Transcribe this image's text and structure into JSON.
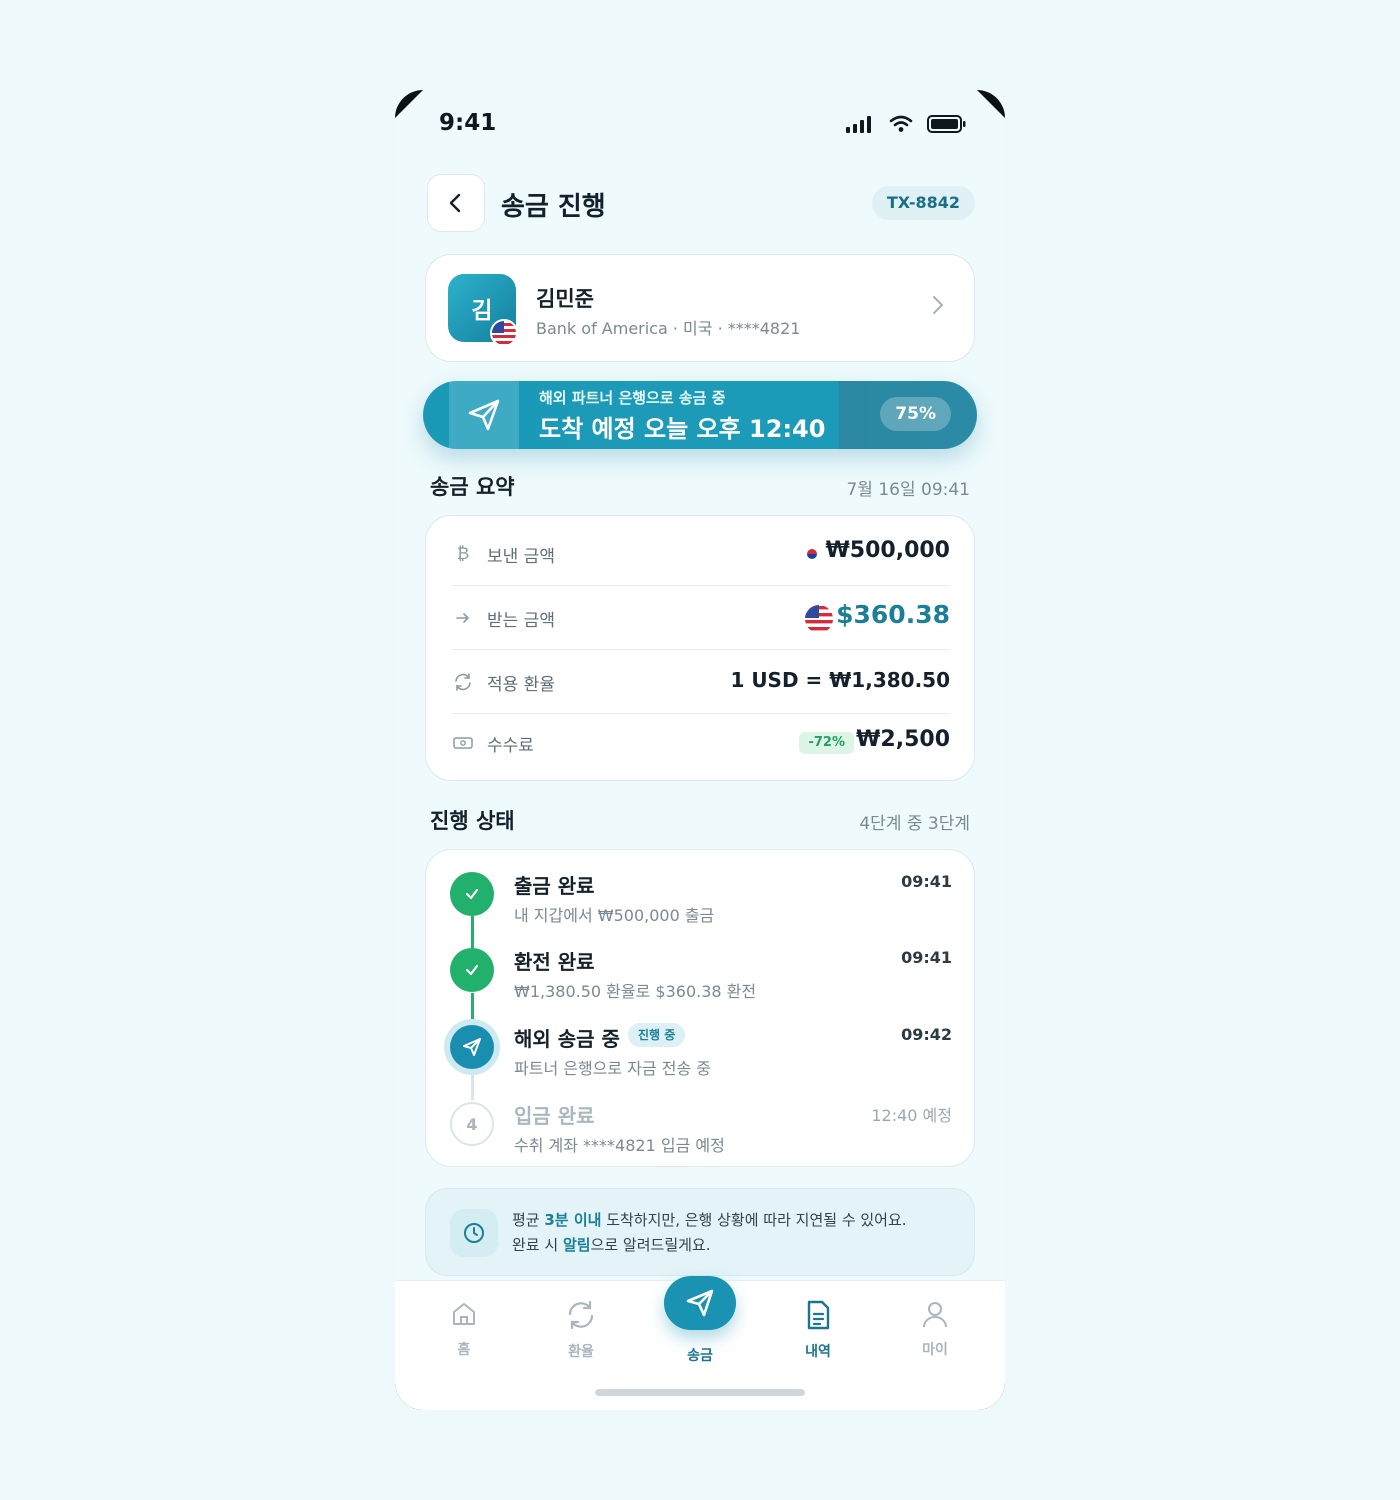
{
  "status_bar": {
    "time": "9:41"
  },
  "header": {
    "title": "송금 진행",
    "tx_id": "TX-8842"
  },
  "recipient": {
    "initial": "김",
    "name": "김민준",
    "details": "Bank of America · 미국 · ****4821"
  },
  "banner": {
    "subtitle": "해외 파트너 은행으로 송금 중",
    "title": "도착 예정 오늘 오후 12:40",
    "progress_label": "75%",
    "progress": 0.75
  },
  "summary": {
    "section_title": "송금 요약",
    "date": "7월 16일 09:41",
    "rows": [
      {
        "icon": "won-icon",
        "label": "보낸 금액",
        "value": "₩500,000"
      },
      {
        "icon": "arrow-right-icon",
        "label": "받는 금액",
        "value": "$360.38"
      },
      {
        "icon": "refresh-icon",
        "label": "적용 환율",
        "value": "1 USD = ₩1,380.50"
      },
      {
        "icon": "cash-icon",
        "label": "수수료",
        "badge": "-72%",
        "value": "₩2,500"
      }
    ]
  },
  "progress": {
    "section_title": "진행 상태",
    "step_count": "4단계 중 3단계",
    "steps": [
      {
        "state": "done",
        "title": "출금 완료",
        "desc": "내 지갑에서 ₩500,000 출금",
        "time": "09:41"
      },
      {
        "state": "done",
        "title": "환전 완료",
        "desc": "₩1,380.50 환율로 $360.38 환전",
        "time": "09:41"
      },
      {
        "state": "active",
        "title": "해외 송금 중",
        "badge": "진행 중",
        "desc": "파트너 은행으로 자금 전송 중",
        "time": "09:42"
      },
      {
        "state": "pending",
        "number": "4",
        "title": "입금 완료",
        "desc": "수취 계좌 ****4821 입금 예정",
        "time": "12:40 예정"
      }
    ]
  },
  "notice": {
    "line1_pre": "평균 ",
    "line1_bold": "3분 이내",
    "line1_post": " 도착하지만, 은행 상황에 따라 지연될 수 있어요.",
    "line2_pre": "완료 시 ",
    "line2_bold": "알림",
    "line2_post": "으로 알려드릴게요."
  },
  "tabbar": {
    "items": [
      {
        "label": "홈",
        "icon": "home-icon"
      },
      {
        "label": "환율",
        "icon": "exchange-icon"
      },
      {
        "label": "송금",
        "icon": "send-icon"
      },
      {
        "label": "내역",
        "icon": "document-icon"
      },
      {
        "label": "마이",
        "icon": "user-icon"
      }
    ],
    "active": "송금"
  },
  "colors": {
    "accent": "#1a92b1",
    "success": "#22b06d",
    "background": "#eef9fb"
  }
}
